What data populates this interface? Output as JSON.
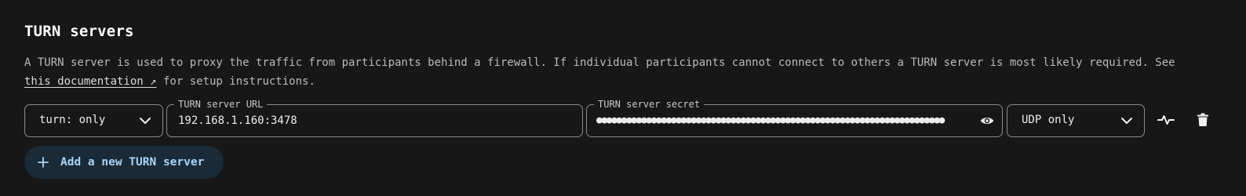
{
  "section": {
    "title": "TURN servers",
    "description_part1": "A TURN server is used to proxy the traffic from participants behind a firewall. If individual participants cannot connect to others a TURN server is most likely required. See ",
    "doc_link": "this documentation ↗",
    "description_part2": " for setup instructions."
  },
  "server_row": {
    "scheme_select": {
      "value": "turn: only"
    },
    "url_field": {
      "legend": "TURN server URL",
      "value": "192.168.1.160:3478"
    },
    "secret_field": {
      "legend": "TURN server secret",
      "value": "●●●●●●●●●●●●●●●●●●●●●●●●●●●●●●●●●●●●●●●●●●●●●●●●●●●●●●●●●●●●●●●●●●●●●●"
    },
    "protocol_select": {
      "value": "UDP only"
    }
  },
  "actions": {
    "add_server_label": "Add a new TURN server"
  },
  "colors": {
    "background": "#171717",
    "add_button_bg": "#1a2a36",
    "add_button_text": "#a9d3f5"
  },
  "icons": [
    "chevron-down-icon",
    "eye-icon",
    "pulse-icon",
    "trash-icon",
    "plus-icon"
  ]
}
